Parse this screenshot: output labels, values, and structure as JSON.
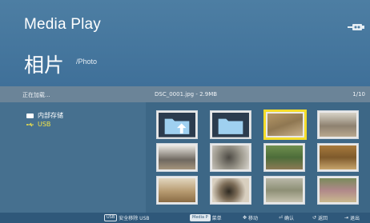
{
  "header": {
    "app_title": "Media Play",
    "page_title": "相片",
    "page_sub": "/Photo"
  },
  "status": {
    "left": "正在加载...",
    "file": "DSC_0001.jpg - 2.9MB",
    "page": "1/10"
  },
  "sidebar": {
    "items": [
      {
        "label": "内部存储",
        "icon": "storage-icon"
      },
      {
        "label": "USB",
        "icon": "usb-icon",
        "selected": true
      }
    ]
  },
  "grid": {
    "items": [
      {
        "type": "folder-up"
      },
      {
        "type": "folder"
      },
      {
        "type": "photo",
        "selected": true
      },
      {
        "type": "photo"
      },
      {
        "type": "photo"
      },
      {
        "type": "photo"
      },
      {
        "type": "photo"
      },
      {
        "type": "photo"
      },
      {
        "type": "photo"
      },
      {
        "type": "photo"
      },
      {
        "type": "photo"
      },
      {
        "type": "photo"
      }
    ]
  },
  "footer": {
    "usb_key": "USB",
    "usb_label": "安全移除 USB",
    "menu_key": "Media P",
    "menu_label": "菜单",
    "move_label": "移动",
    "ok_label": "确认",
    "back_label": "返回",
    "exit_label": "退出"
  },
  "colors": {
    "accent": "#f3dc2b",
    "header": "#4d7ea3",
    "status": "#6b8498",
    "footer": "#2f587a"
  }
}
